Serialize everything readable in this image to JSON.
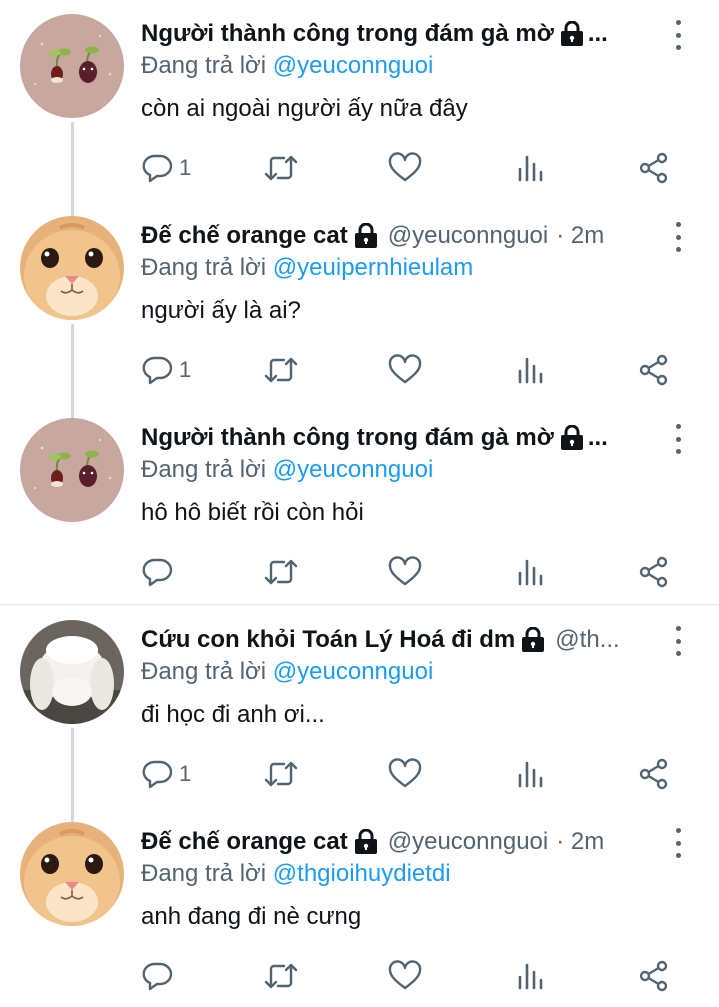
{
  "tweets": [
    {
      "name": "Người thành công trong đám gà mờ",
      "handle": "",
      "time": "",
      "truncated": true,
      "reply_label": "Đang trả lời",
      "reply_to": "@yeuconnguoi",
      "content": "còn ai ngoài người ấy nữa đây",
      "reply_count": "1",
      "avatar": "sprout-avatar"
    },
    {
      "name": "Đế chế orange cat",
      "handle": "@yeuconnguoi",
      "time": "· 2m",
      "truncated": false,
      "reply_label": "Đang trả lời",
      "reply_to": "@yeuipernhieulam",
      "content": "người ấy là ai?",
      "reply_count": "1",
      "avatar": "orange-cat-avatar"
    },
    {
      "name": "Người thành công trong đám gà mờ",
      "handle": "",
      "time": "",
      "truncated": true,
      "reply_label": "Đang trả lời",
      "reply_to": "@yeuconnguoi",
      "content": "hô hô biết rồi còn hỏi",
      "reply_count": "",
      "avatar": "sprout-avatar"
    },
    {
      "name": "Cứu con khỏi Toán Lý Hoá đi dm",
      "handle": "@th...",
      "time": "",
      "truncated": false,
      "reply_label": "Đang trả lời",
      "reply_to": "@yeuconnguoi",
      "content": "đi học đi anh ơi...",
      "reply_count": "1",
      "avatar": "white-rabbit-avatar"
    },
    {
      "name": "Đế chế orange cat",
      "handle": "@yeuconnguoi",
      "time": "· 2m",
      "truncated": false,
      "reply_label": "Đang trả lời",
      "reply_to": "@thgioihuydietdi",
      "content": "anh đang đi nè cưng",
      "reply_count": "",
      "avatar": "orange-cat-avatar"
    }
  ],
  "truncation": "...",
  "icons": [
    "reply-icon",
    "retweet-icon",
    "like-icon",
    "views-icon",
    "share-icon",
    "lock-icon",
    "more-icon"
  ],
  "colors": {
    "link": "#1d9bf0",
    "secondary": "#536471",
    "text": "#0f1419",
    "thread_line": "#cfd9de"
  }
}
